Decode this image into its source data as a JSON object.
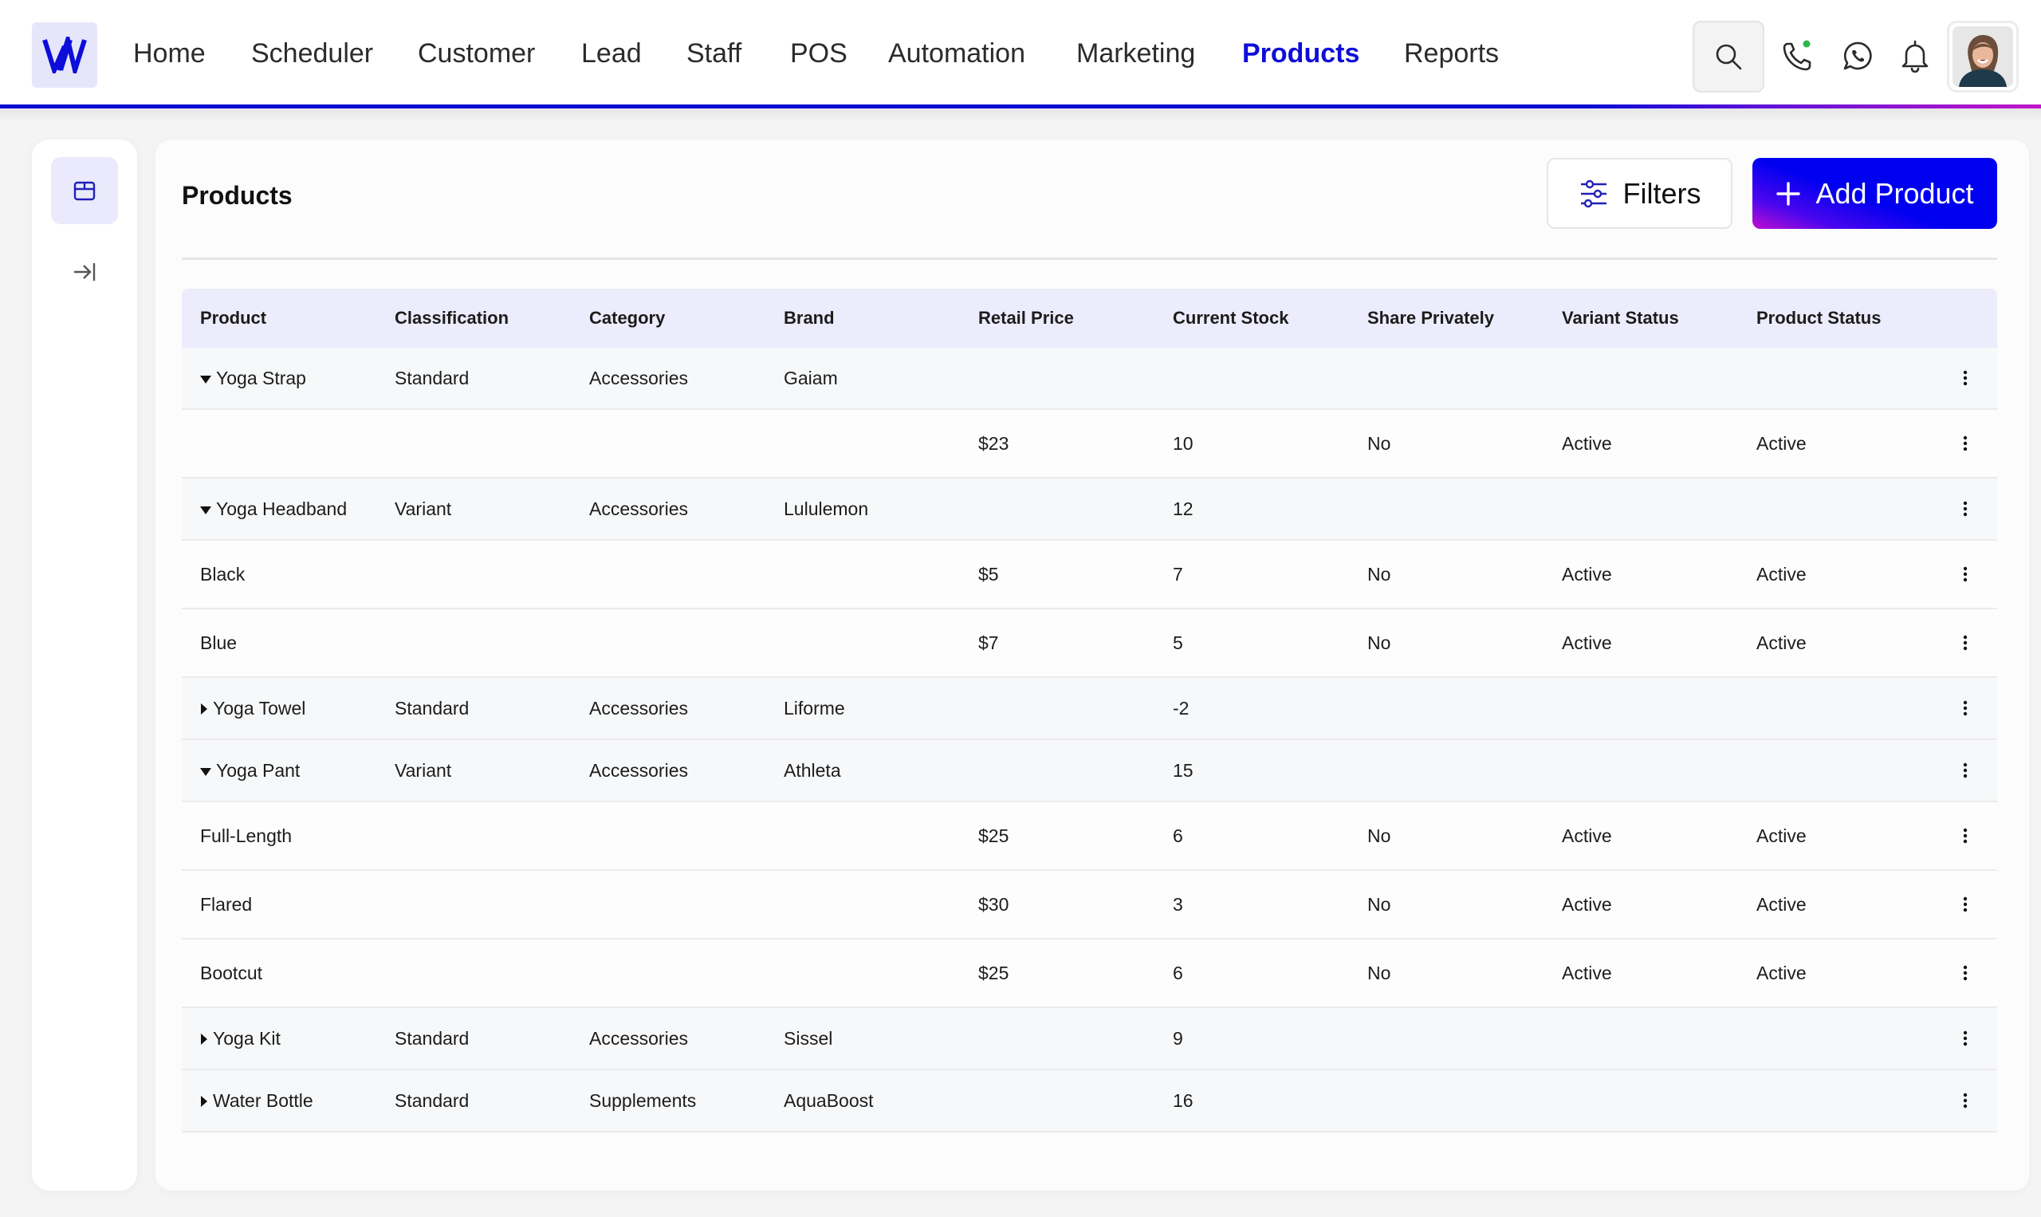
{
  "header": {
    "logo_letter": "W",
    "nav": [
      {
        "label": "Home",
        "active": false
      },
      {
        "label": "Scheduler",
        "active": false
      },
      {
        "label": "Customer",
        "active": false
      },
      {
        "label": "Lead",
        "active": false
      },
      {
        "label": "Staff",
        "active": false
      },
      {
        "label": "POS",
        "active": false
      },
      {
        "label": "Automation",
        "active": false
      },
      {
        "label": "Marketing",
        "active": false
      },
      {
        "label": "Products",
        "active": true
      },
      {
        "label": "Reports",
        "active": false
      }
    ],
    "icons": [
      "search-icon",
      "phone-icon",
      "whatsapp-icon",
      "bell-icon"
    ],
    "phone_status_color": "#2db84d",
    "accent_color": "#0d0dd9"
  },
  "sidebar": {
    "items": [
      {
        "icon": "box-icon",
        "active": true
      },
      {
        "icon": "expand-sidebar-icon",
        "active": false
      }
    ]
  },
  "main": {
    "title": "Products",
    "filters_label": "Filters",
    "add_label": "Add Product"
  },
  "table": {
    "columns": [
      "Product",
      "Classification",
      "Category",
      "Brand",
      "Retail Price",
      "Current Stock",
      "Share Privately",
      "Variant Status",
      "Product Status"
    ],
    "rows": [
      {
        "type": "parent",
        "expanded": true,
        "cells": [
          "Yoga Strap",
          "Standard",
          "Accessories",
          "Gaiam",
          "",
          "",
          "",
          "",
          ""
        ]
      },
      {
        "type": "child",
        "cells": [
          "",
          "",
          "",
          "",
          "$23",
          "10",
          "No",
          "Active",
          "Active"
        ]
      },
      {
        "type": "parent",
        "expanded": true,
        "cells": [
          "Yoga Headband",
          "Variant",
          "Accessories",
          "Lululemon",
          "",
          "12",
          "",
          "",
          ""
        ]
      },
      {
        "type": "child",
        "cells": [
          "Black",
          "",
          "",
          "",
          "$5",
          "7",
          "No",
          "Active",
          "Active"
        ]
      },
      {
        "type": "child",
        "cells": [
          "Blue",
          "",
          "",
          "",
          "$7",
          "5",
          "No",
          "Active",
          "Active"
        ]
      },
      {
        "type": "parent",
        "expanded": false,
        "cells": [
          "Yoga Towel",
          "Standard",
          "Accessories",
          "Liforme",
          "",
          "-2",
          "",
          "",
          ""
        ]
      },
      {
        "type": "parent",
        "expanded": true,
        "cells": [
          "Yoga Pant",
          "Variant",
          "Accessories",
          "Athleta",
          "",
          "15",
          "",
          "",
          ""
        ]
      },
      {
        "type": "child",
        "cells": [
          "Full-Length",
          "",
          "",
          "",
          "$25",
          "6",
          "No",
          "Active",
          "Active"
        ]
      },
      {
        "type": "child",
        "cells": [
          "Flared",
          "",
          "",
          "",
          "$30",
          "3",
          "No",
          "Active",
          "Active"
        ]
      },
      {
        "type": "child",
        "cells": [
          "Bootcut",
          "",
          "",
          "",
          "$25",
          "6",
          "No",
          "Active",
          "Active"
        ]
      },
      {
        "type": "parent",
        "expanded": false,
        "cells": [
          "Yoga Kit",
          "Standard",
          "Accessories",
          "Sissel",
          "",
          "9",
          "",
          "",
          ""
        ]
      },
      {
        "type": "parent",
        "expanded": false,
        "cells": [
          "Water Bottle",
          "Standard",
          "Supplements",
          "AquaBoost",
          "",
          "16",
          "",
          "",
          ""
        ]
      }
    ]
  }
}
